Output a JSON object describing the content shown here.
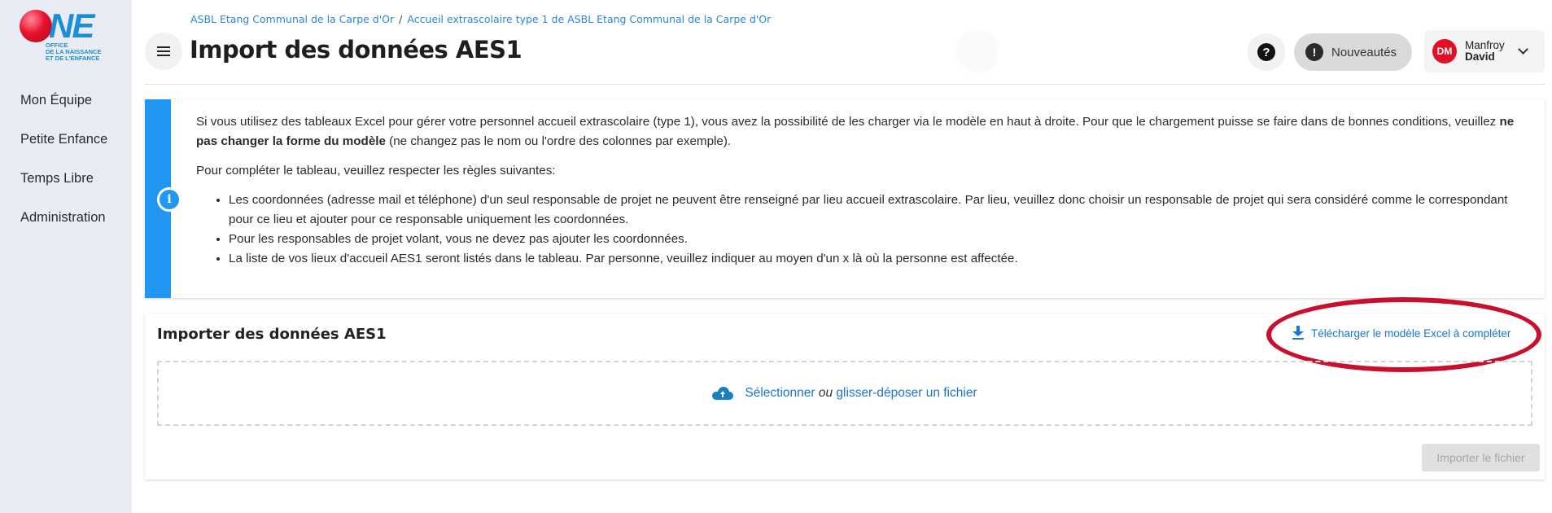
{
  "logo": {
    "brand": "NE",
    "tagline": [
      "Office",
      "de la naissance",
      "et de l'enfance"
    ]
  },
  "sidebar": {
    "items": [
      {
        "label": "Mon Équipe"
      },
      {
        "label": "Petite Enfance"
      },
      {
        "label": "Temps Libre"
      },
      {
        "label": "Administration"
      }
    ]
  },
  "breadcrumb": {
    "items": [
      {
        "label": "ASBL Etang Communal de la Carpe d'Or"
      },
      {
        "label": "Accueil extrascolaire type 1 de ASBL Etang Communal de la Carpe d'Or"
      }
    ],
    "separator": "/"
  },
  "header": {
    "title": "Import des données AES1",
    "help_icon": "?",
    "news_icon": "!",
    "news_label": "Nouveautés",
    "user": {
      "initials": "DM",
      "first_line": "Manfroy",
      "second_line": "David"
    }
  },
  "info": {
    "icon": "i",
    "p1_start": "Si vous utilisez des tableaux Excel pour gérer votre personnel accueil extrascolaire (type 1), vous avez la possibilité de les charger via le modèle en haut à droite. Pour que le chargement puisse se faire dans de bonnes conditions, veuillez ",
    "p1_bold": "ne pas changer la forme du modèle",
    "p1_end": " (ne changez pas le nom ou l'ordre des colonnes par exemple).",
    "p2": "Pour compléter le tableau, veuillez respecter les règles suivantes:",
    "rules": [
      "Les coordonnées (adresse mail et téléphone) d'un seul responsable de projet ne peuvent être renseigné par lieu accueil extrascolaire. Par lieu, veuillez donc choisir un responsable de projet qui sera considéré comme le correspondant pour ce lieu et ajouter pour ce responsable uniquement les coordonnées.",
      "Pour les responsables de projet volant, vous ne devez pas ajouter les coordonnées.",
      "La liste de vos lieux d'accueil AES1 seront listés dans le tableau. Par personne, veuillez indiquer au moyen d'un x là où la personne est affectée."
    ]
  },
  "import": {
    "title": "Importer des données AES1",
    "download_label": "Télécharger le modèle Excel à compléter",
    "dropzone_select": "Sélectionner ",
    "dropzone_or": "ou",
    "dropzone_drop": " glisser-déposer un fichier",
    "import_button": "Importer le fichier"
  },
  "colors": {
    "accent": "#2196f3",
    "link": "#1976d2",
    "highlight_ellipse": "#c8102e",
    "brand_red": "#e30f26",
    "sidebar_bg": "#e9ecf4"
  }
}
